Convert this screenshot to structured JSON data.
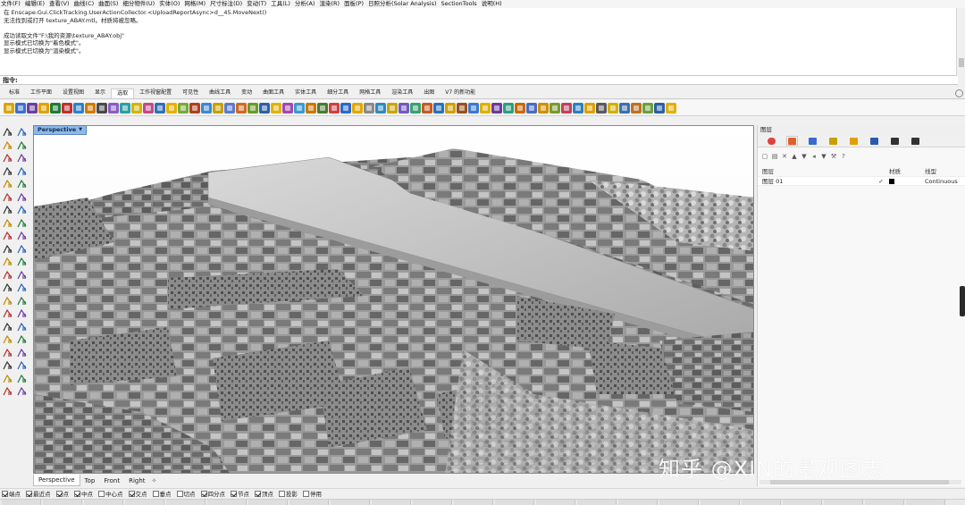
{
  "menu": [
    "文件(F)",
    "编辑(E)",
    "查看(V)",
    "曲线(C)",
    "曲面(S)",
    "细分物件(U)",
    "实体(O)",
    "网格(M)",
    "尺寸标注(D)",
    "变动(T)",
    "工具(L)",
    "分析(A)",
    "渲染(R)",
    "面板(P)",
    "日照分析(Solar Analysis)",
    "SectionTools",
    "说明(H)"
  ],
  "command_history": [
    "在 Enscape.Gui.ClickTracking.UserActionCollector.<UploadReportAsync>d__45.MoveNext()",
    "无法找到或打开 texture_ABAY.mtl。材质将被忽略。",
    "",
    "成功读取文件\"F:\\我的资源\\texture_ABAY.obj\"",
    "显示模式已切换为\"着色模式\"。",
    "显示模式已切换为\"渲染模式\"。",
    "",
    ""
  ],
  "command_prompt": "指令:",
  "tabs": [
    {
      "label": "标准",
      "active": false
    },
    {
      "label": "工作平面",
      "active": false
    },
    {
      "label": "设置视图",
      "active": false
    },
    {
      "label": "显示",
      "active": false
    },
    {
      "label": "选取",
      "active": true
    },
    {
      "label": "工作视窗配置",
      "active": false
    },
    {
      "label": "可见性",
      "active": false
    },
    {
      "label": "曲线工具",
      "active": false
    },
    {
      "label": "变动",
      "active": false
    },
    {
      "label": "曲面工具",
      "active": false
    },
    {
      "label": "实体工具",
      "active": false
    },
    {
      "label": "细分工具",
      "active": false
    },
    {
      "label": "网格工具",
      "active": false
    },
    {
      "label": "渲染工具",
      "active": false
    },
    {
      "label": "出图",
      "active": false
    },
    {
      "label": "V7 的新功能",
      "active": false
    }
  ],
  "viewport": {
    "title": "Perspective",
    "tabs": [
      "Perspective",
      "Top",
      "Front",
      "Right"
    ],
    "active_tab": "Perspective"
  },
  "watermark": "知乎 @XIN的景观图志",
  "layer_panel": {
    "title": "图层",
    "columns": {
      "name": "图层",
      "material": "材质",
      "linetype": "线型"
    },
    "rows": [
      {
        "name": "图层 01",
        "current": "✓",
        "linetype": "Continuous"
      }
    ]
  },
  "osnaps": [
    {
      "label": "端点",
      "checked": true
    },
    {
      "label": "最近点",
      "checked": true
    },
    {
      "label": "点",
      "checked": true
    },
    {
      "label": "中点",
      "checked": true
    },
    {
      "label": "中心点",
      "checked": false
    },
    {
      "label": "交点",
      "checked": true
    },
    {
      "label": "垂点",
      "checked": false
    },
    {
      "label": "切点",
      "checked": false
    },
    {
      "label": "四分点",
      "checked": true
    },
    {
      "label": "节点",
      "checked": true
    },
    {
      "label": "顶点",
      "checked": true
    },
    {
      "label": "投影",
      "checked": false
    },
    {
      "label": "停用",
      "checked": false
    }
  ],
  "colors": {
    "viewport_title_bg": "#8fb8e6",
    "active_tab_bg": "#ffffff",
    "watermark": "#ffffff"
  },
  "icons": {
    "layer_tab_icons": [
      "color-wheel-icon",
      "layers-icon",
      "render-icon",
      "brush-icon",
      "folder-icon",
      "display-icon",
      "camera-icon",
      "monitor-icon"
    ],
    "layer_tool_icons": [
      "new-layer-icon",
      "new-sublayer-icon",
      "delete-icon",
      "move-up-icon",
      "move-down-icon",
      "up-level-icon",
      "filter-icon",
      "tools-icon",
      "help-icon"
    ]
  }
}
